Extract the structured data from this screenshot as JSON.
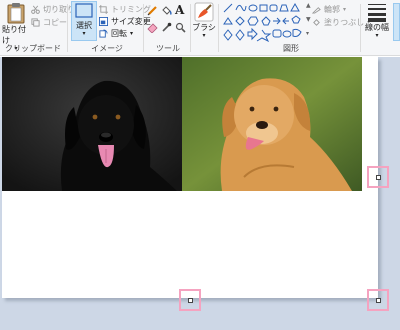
{
  "ribbon": {
    "clipboard": {
      "paste_label": "貼り付け",
      "cut_label": "切り取り",
      "copy_label": "コピー",
      "group_label": "クリップボード"
    },
    "image": {
      "select_label": "選択",
      "crop_label": "トリミング",
      "resize_label": "サイズ変更",
      "rotate_label": "回転",
      "group_label": "イメージ"
    },
    "tools": {
      "text_tool": "A",
      "group_label": "ツール"
    },
    "brushes": {
      "label": "ブラシ"
    },
    "shapes": {
      "outline_label": "輪郭",
      "fill_label": "塗りつぶし",
      "group_label": "図形"
    },
    "size": {
      "label": "線の幅"
    }
  },
  "colors": {
    "accent_selected": "#cce4f7",
    "pink_handle": "#f5a3c0",
    "canvas_bg": "#cdd7e6"
  },
  "icons": [
    "clipboard-icon",
    "scissors-icon",
    "copy-icon",
    "select-icon",
    "crop-icon",
    "resize-icon",
    "rotate-icon",
    "pencil-icon",
    "fill-icon",
    "text-icon",
    "eraser-icon",
    "picker-icon",
    "magnifier-icon",
    "brush-icon",
    "shape-gallery",
    "line-width-icon"
  ]
}
